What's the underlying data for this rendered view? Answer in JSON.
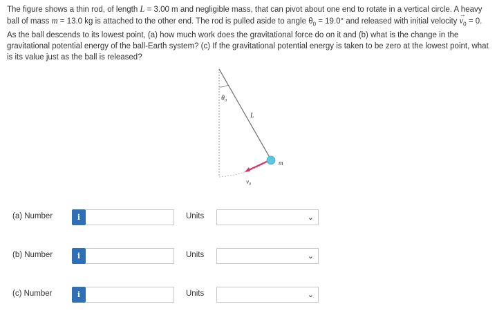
{
  "problem": {
    "p1": "The figure shows a thin rod, of length ",
    "L": "L",
    "p2": " = 3.00 m and negligible mass, that can pivot about one end to rotate in a vertical circle. A heavy ball of mass ",
    "m": "m",
    "p3": " = 13.0 kg is attached to the other end. The rod is pulled aside to angle θ",
    "sub0a": "0",
    "p4": " = 19.0° and released with initial velocity ",
    "v": "v",
    "sub0b": "0",
    "p5": " = 0. As the ball descends to its lowest point, (a) how much work does the gravitational force do on it and (b) what is the change in the gravitational potential energy of the ball-Earth system? (c) If the gravitational potential energy is taken to be zero at the lowest point, what is its value just as the ball is released?"
  },
  "figure": {
    "theta_label": "θ₀",
    "rod_label": "L",
    "mass_label": "m",
    "velocity_label": "v₀"
  },
  "rows": [
    {
      "label": "(a)   Number",
      "info": "i",
      "value": "",
      "units_label": "Units",
      "units_value": "",
      "chevron": "⌄"
    },
    {
      "label": "(b)   Number",
      "info": "i",
      "value": "",
      "units_label": "Units",
      "units_value": "",
      "chevron": "⌄"
    },
    {
      "label": "(c)   Number",
      "info": "i",
      "value": "",
      "units_label": "Units",
      "units_value": "",
      "chevron": "⌄"
    }
  ],
  "colors": {
    "info_button": "#2f6fb5",
    "ball": "#5bc8e0",
    "velocity_segment": "#d6336c",
    "rod": "#777777"
  }
}
